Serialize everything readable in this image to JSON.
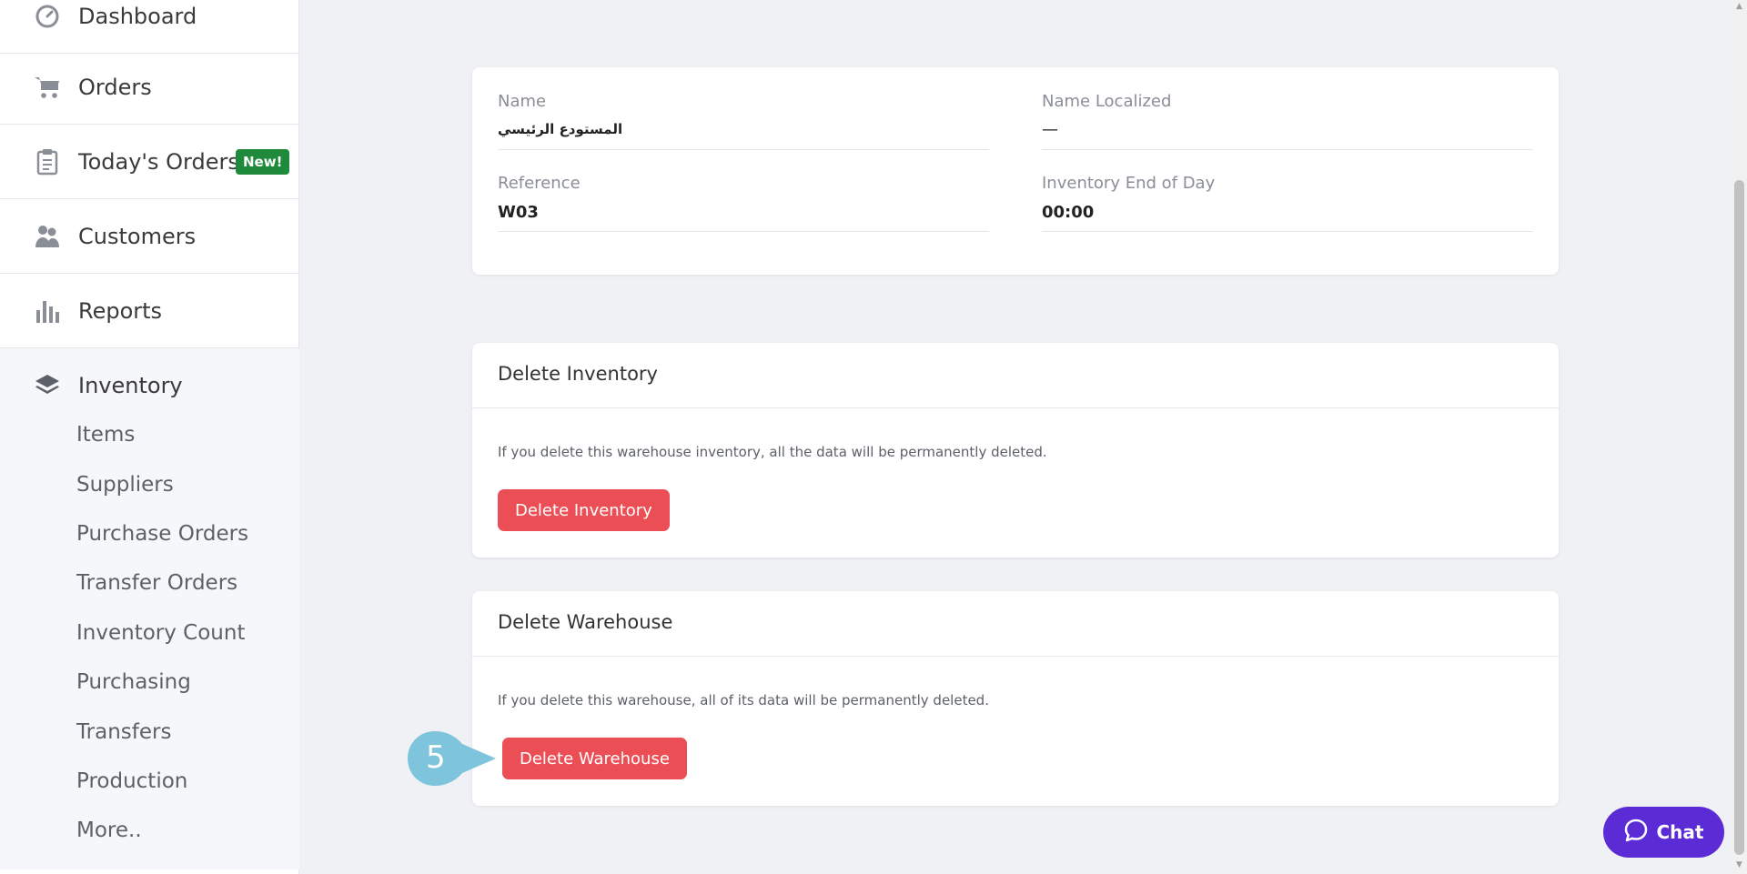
{
  "sidebar": {
    "items": [
      {
        "label": "Dashboard",
        "icon": "dashboard-icon"
      },
      {
        "label": "Orders",
        "icon": "cart-icon"
      },
      {
        "label": "Today's Orders",
        "icon": "clipboard-icon",
        "badge": "New!"
      },
      {
        "label": "Customers",
        "icon": "customers-icon"
      },
      {
        "label": "Reports",
        "icon": "reports-icon"
      }
    ],
    "inventory": {
      "label": "Inventory",
      "icon": "layers-icon",
      "children": [
        "Items",
        "Suppliers",
        "Purchase Orders",
        "Transfer Orders",
        "Inventory Count",
        "Purchasing",
        "Transfers",
        "Production",
        "More.."
      ]
    }
  },
  "details": {
    "name_label": "Name",
    "name_value": "المستودع الرئيسي",
    "name_localized_label": "Name Localized",
    "name_localized_value": "—",
    "reference_label": "Reference",
    "reference_value": "W03",
    "end_of_day_label": "Inventory End of Day",
    "end_of_day_value": "00:00"
  },
  "delete_inventory": {
    "title": "Delete Inventory",
    "text": "If you delete this warehouse inventory, all the data will be permanently deleted.",
    "button": "Delete Inventory"
  },
  "delete_warehouse": {
    "title": "Delete Warehouse",
    "text": "If you delete this warehouse, all of its data will be permanently deleted.",
    "button": "Delete Warehouse"
  },
  "step_marker": "5",
  "chat": {
    "label": "Chat",
    "icon": "chat-bubble-icon"
  },
  "colors": {
    "danger": "#ec4e55",
    "chat": "#5b2bd6",
    "badge": "#1f8a3b",
    "step_marker": "#7ec4dc"
  }
}
